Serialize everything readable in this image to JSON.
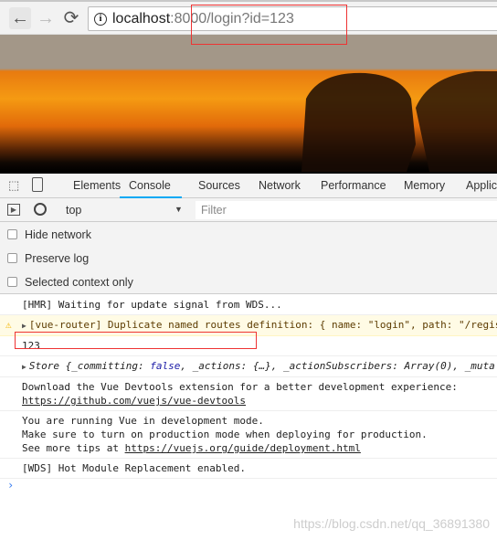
{
  "browser": {
    "back": "←",
    "forward": "→",
    "reload": "⟳",
    "url_host": "localhost",
    "url_rest": ":8000/login?id=123"
  },
  "devtools": {
    "tabs": [
      "Elements",
      "Console",
      "Sources",
      "Network",
      "Performance",
      "Memory",
      "Applic"
    ],
    "active_tab": "Console",
    "context": "top",
    "filter_placeholder": "Filter",
    "options": [
      "Hide network",
      "Preserve log",
      "Selected context only"
    ]
  },
  "console": {
    "l1": "[HMR] Waiting for update signal from WDS...",
    "l2": "[vue-router] Duplicate named routes definition: { name: \"login\", path: \"/regis",
    "l3": "123",
    "l4a": "Store {_committing: ",
    "l4b": "false",
    "l4c": ", _actions: {…}, _actionSubscribers: Array(0), _muta",
    "l5a": "Download the Vue Devtools extension for a better development experience:",
    "l5b": "https://github.com/vuejs/vue-devtools",
    "l6a": "You are running Vue in development mode.",
    "l6b": "Make sure to turn on production mode when deploying for production.",
    "l6c": "See more tips at ",
    "l6d": "https://vuejs.org/guide/deployment.html",
    "l7": "[WDS] Hot Module Replacement enabled.",
    "prompt": "›"
  },
  "watermark": "https://blog.csdn.net/qq_36891380"
}
